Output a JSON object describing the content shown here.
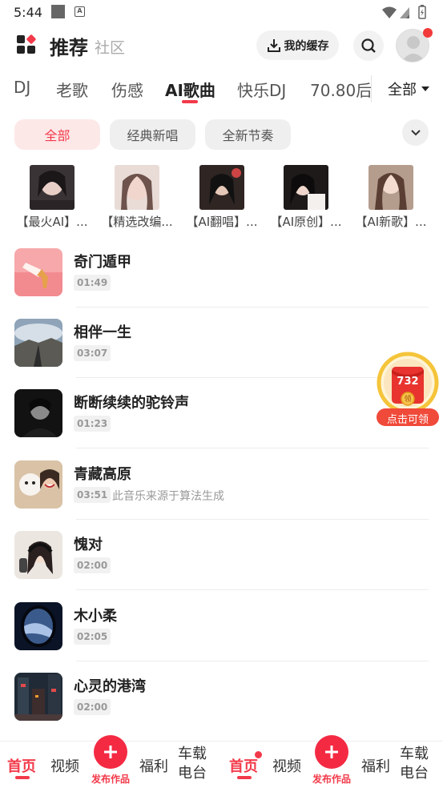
{
  "status_bar": {
    "time": "5:44"
  },
  "header": {
    "title": "推荐",
    "subtitle": "社区",
    "cache_label": "我的缓存"
  },
  "tabs": [
    "DJ",
    "老歌",
    "伤感",
    "AI歌曲",
    "快乐DJ",
    "70.80后"
  ],
  "active_tab": "AI歌曲",
  "tab_all": "全部",
  "chips": [
    "全部",
    "经典新唱",
    "全新节奏"
  ],
  "playlists": [
    {
      "label": "【最火AI】..."
    },
    {
      "label": "【精选改编..."
    },
    {
      "label": "【AI翻唱】..."
    },
    {
      "label": "【AI原创】..."
    },
    {
      "label": "【AI新歌】..."
    }
  ],
  "songs": [
    {
      "name": "奇门遁甲",
      "duration": "01:49"
    },
    {
      "name": "相伴一生",
      "duration": "03:07"
    },
    {
      "name": "断断续续的驼铃声",
      "duration": "01:23"
    },
    {
      "name": "青藏高原",
      "duration": "03:51",
      "note": "此音乐来源于算法生成"
    },
    {
      "name": "愧对",
      "duration": "02:00"
    },
    {
      "name": "木小柔",
      "duration": "02:05"
    },
    {
      "name": "心灵的港湾",
      "duration": "02:00"
    }
  ],
  "float_award": {
    "count": "732",
    "coin": "领",
    "label": "点击可领"
  },
  "bottom_nav": {
    "home": "首页",
    "video": "视频",
    "publish": "发布作品",
    "welfare": "福利",
    "car_1": "车载",
    "car_2": "电台",
    "home2": "首页",
    "video2": "视频",
    "publish2": "发布作品",
    "welfare2": "福利",
    "car2_1": "车载",
    "car2_2": "电台"
  },
  "colors": {
    "accent": "#f23a4a",
    "chip_active_bg": "#fde8e8"
  }
}
